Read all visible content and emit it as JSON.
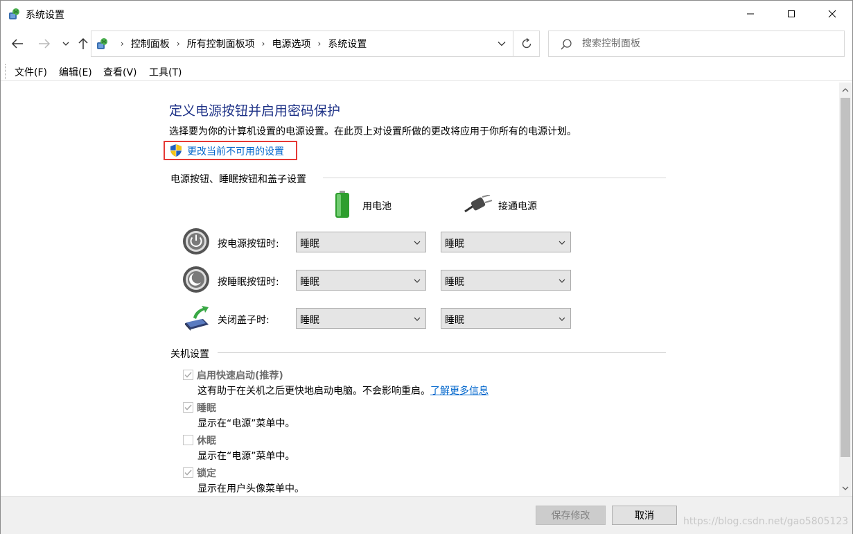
{
  "window": {
    "title": "系统设置"
  },
  "address": {
    "crumbs": [
      "控制面板",
      "所有控制面板项",
      "电源选项",
      "系统设置"
    ]
  },
  "search": {
    "placeholder": "搜索控制面板"
  },
  "menu": {
    "items": [
      "文件(F)",
      "编辑(E)",
      "查看(V)",
      "工具(T)"
    ]
  },
  "main": {
    "title": "定义电源按钮并启用密码保护",
    "description": "选择要为你的计算机设置的电源设置。在此页上对设置所做的更改将应用于你所有的电源计划。",
    "change_link": "更改当前不可用的设置",
    "power_section": {
      "title": "电源按钮、睡眠按钮和盖子设置",
      "columns": [
        "用电池",
        "接通电源"
      ],
      "rows": [
        {
          "label": "按电源按钮时:",
          "battery": "睡眠",
          "plugged": "睡眠",
          "icon": "power-button-icon"
        },
        {
          "label": "按睡眠按钮时:",
          "battery": "睡眠",
          "plugged": "睡眠",
          "icon": "sleep-button-icon"
        },
        {
          "label": "关闭盖子时:",
          "battery": "睡眠",
          "plugged": "睡眠",
          "icon": "laptop-lid-icon"
        }
      ]
    },
    "shutdown_section": {
      "title": "关机设置",
      "items": [
        {
          "label": "启用快速启动(推荐)",
          "desc": "这有助于在关机之后更快地启动电脑。不会影响重启。",
          "link": "了解更多信息",
          "checked": true
        },
        {
          "label": "睡眠",
          "desc": "显示在“电源”菜单中。",
          "checked": true
        },
        {
          "label": "休眠",
          "desc": "显示在“电源”菜单中。",
          "checked": false
        },
        {
          "label": "锁定",
          "desc": "显示在用户头像菜单中。",
          "checked": true
        }
      ]
    }
  },
  "footer": {
    "save_label": "保存修改",
    "cancel_label": "取消",
    "watermark": "https://blog.csdn.net/gao5805123"
  },
  "colors": {
    "title_blue": "#1e3287",
    "link_blue": "#0066cc",
    "highlight_red": "#e53935"
  }
}
